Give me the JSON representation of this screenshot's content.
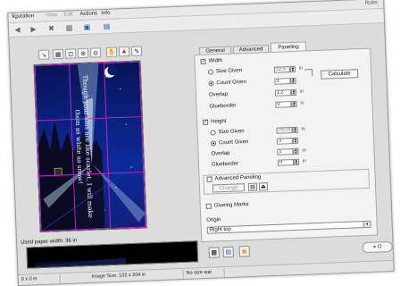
{
  "menu": {
    "items": [
      {
        "label": "figuration"
      },
      {
        "label": "View"
      },
      {
        "label": "Edit"
      },
      {
        "label": "Actions"
      },
      {
        "label": "Info"
      }
    ],
    "window_title": "Ruler"
  },
  "toolbar": {
    "icons": [
      "back-icon",
      "forward-icon",
      "stop-icon",
      "grid-icon",
      "folder-icon",
      "print-icon"
    ]
  },
  "tools": {
    "icons": [
      "arrow-icon",
      "grid-icon",
      "crop-icon",
      "zoom-in-icon",
      "zoom-out-icon",
      "hand-icon",
      "warning-icon",
      "pencil-icon"
    ]
  },
  "preview": {
    "text_top": "Though your sins are like scarlet, I will make",
    "text_bottom": "them as white as snow!"
  },
  "paper": {
    "used_label": "Used paper width: 36 in"
  },
  "status": {
    "coords": "0 x 0 in",
    "image_size": "Image Size: 102 x 204 in",
    "size_warning": "No size war"
  },
  "tabs": [
    {
      "label": "General",
      "active": false
    },
    {
      "label": "Advanced",
      "active": false
    },
    {
      "label": "Paneling",
      "active": true
    }
  ],
  "width": {
    "label": "Width",
    "checked": true,
    "size_given_label": "Size Given",
    "size_given_value": "12.5",
    "size_given_unit": "in",
    "count_given_label": "Count Given",
    "count_given_value": "3",
    "overlap_label": "Overlap",
    "overlap_value": "1.2",
    "overlap_unit": "in",
    "glueborder_label": "Glueborder",
    "glueborder_value": "0",
    "glueborder_unit": "in",
    "calculate_label": "Calculate"
  },
  "height": {
    "label": "Height",
    "checked": true,
    "size_given_label": "Size Given",
    "size_given_value": "70.74",
    "size_given_unit": "in",
    "count_given_label": "Count Given",
    "count_given_value": "3",
    "overlap_label": "Overlap",
    "overlap_value": "1",
    "overlap_unit": "in",
    "glueborder_label": "Glueborder",
    "glueborder_value": "0",
    "glueborder_unit": "in"
  },
  "advanced_paneling": {
    "label": "Advanced Paneling",
    "checked": false,
    "change_label": "Change"
  },
  "glueing_marks": {
    "label": "Glueing Marks",
    "checked": false
  },
  "origin": {
    "label": "Origin",
    "value": "Right top"
  },
  "footer": {
    "ok_label": "O"
  },
  "colors": {
    "preview_sky": "#0b1f7a",
    "grid_line": "#d51fd5",
    "beam": "#9fd8ff"
  }
}
